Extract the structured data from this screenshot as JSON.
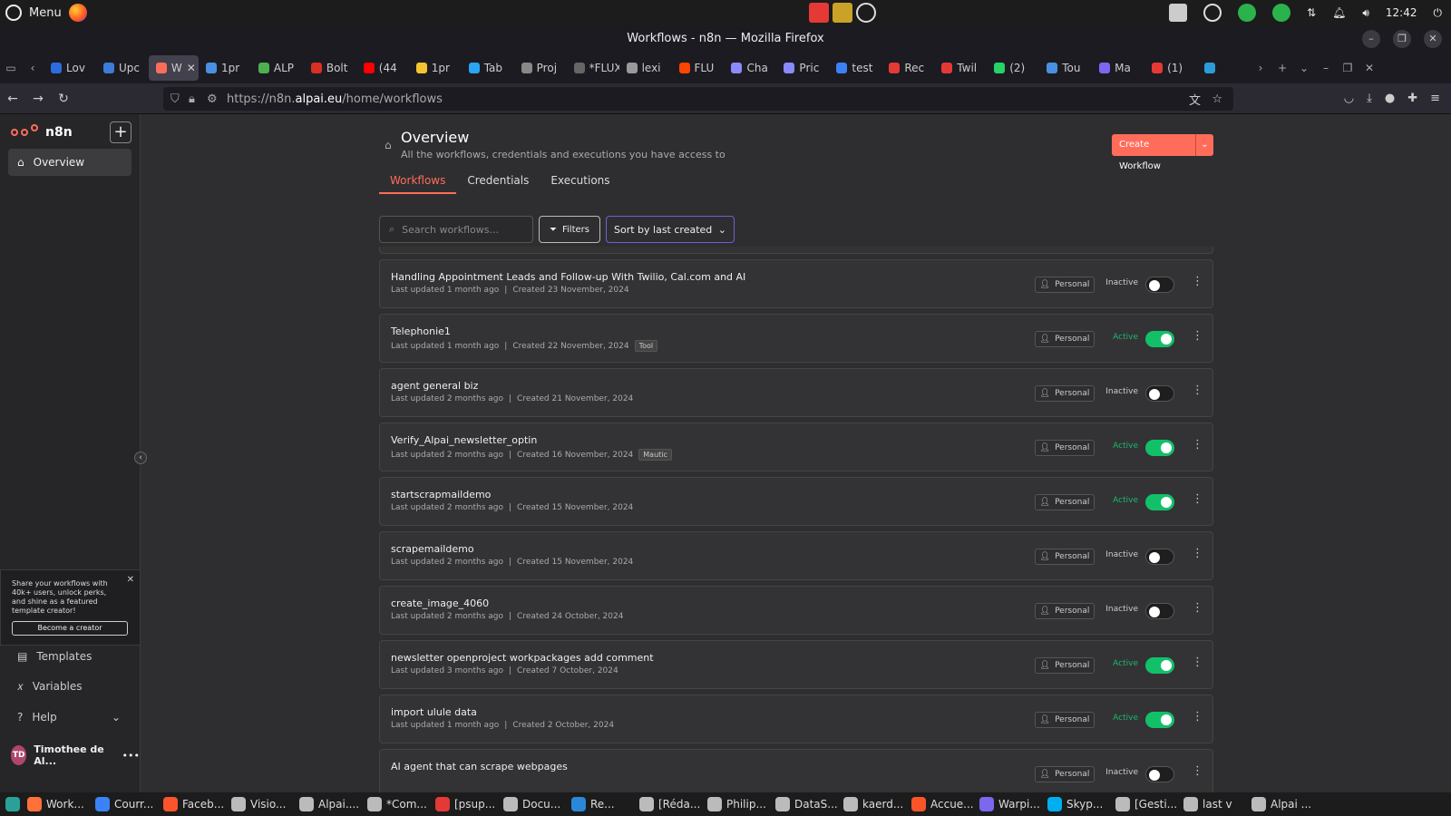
{
  "system": {
    "menu_label": "Menu",
    "clock": "12:42"
  },
  "window": {
    "title": "Workflows - n8n — Mozilla Firefox"
  },
  "browser_tabs": [
    {
      "label": "Lov",
      "color": "#2d6cdf"
    },
    {
      "label": "Upc",
      "color": "#3d7bd9"
    },
    {
      "label": "W",
      "color": "#ff6d5a",
      "active": true
    },
    {
      "label": "1pr",
      "color": "#4a90e2"
    },
    {
      "label": "ALP",
      "color": "#4caf50"
    },
    {
      "label": "Bolt",
      "color": "#d93025"
    },
    {
      "label": "(44",
      "color": "#ff0000"
    },
    {
      "label": "1pr",
      "color": "#f4c430"
    },
    {
      "label": "Tab",
      "color": "#2aa4f4"
    },
    {
      "label": "Proj",
      "color": "#888888"
    },
    {
      "label": "*FLUX",
      "color": "#666666"
    },
    {
      "label": "lexi",
      "color": "#999999"
    },
    {
      "label": "FLU",
      "color": "#ff4500"
    },
    {
      "label": "Cha",
      "color": "#8a8aff"
    },
    {
      "label": "Pric",
      "color": "#8a8aff"
    },
    {
      "label": "test",
      "color": "#3b82f6"
    },
    {
      "label": "Rec",
      "color": "#e53935"
    },
    {
      "label": "Twil",
      "color": "#e53935"
    },
    {
      "label": "(2)",
      "color": "#25d366"
    },
    {
      "label": "Tou",
      "color": "#4a90e2"
    },
    {
      "label": "Ma",
      "color": "#7b68ee"
    },
    {
      "label": "(1)",
      "color": "#e53935"
    },
    {
      "label": "",
      "color": "#2d9cdb"
    }
  ],
  "url": {
    "prefix": "https://n8n.",
    "host": "alpai.eu",
    "path": "/home/workflows"
  },
  "sidebar": {
    "brand": "n8n",
    "overview": "Overview",
    "templates": "Templates",
    "variables": "Variables",
    "help": "Help",
    "promo_text": "Share your workflows with 40k+ users, unlock perks, and shine as a featured template creator!",
    "promo_cta": "Become a creator",
    "user_initials": "TD",
    "user_name": "Timothee de Al..."
  },
  "header": {
    "title": "Overview",
    "subtitle": "All the workflows, credentials and executions you have access to",
    "create_label": "Create Workflow"
  },
  "tabs": {
    "workflows": "Workflows",
    "credentials": "Credentials",
    "executions": "Executions"
  },
  "toolbar": {
    "search_placeholder": "Search workflows...",
    "filters": "Filters",
    "sort": "Sort by last created"
  },
  "workflows": [
    {
      "name": "Handling Appointment Leads and Follow-up With Twilio, Cal.com and AI",
      "updated": "Last updated 1 month ago",
      "created": "Created 23 November, 2024",
      "tag": "",
      "owner": "Personal",
      "status": "Inactive",
      "active": false
    },
    {
      "name": "Telephonie1",
      "updated": "Last updated 1 month ago",
      "created": "Created 22 November, 2024",
      "tag": "Tool",
      "owner": "Personal",
      "status": "Active",
      "active": true
    },
    {
      "name": "agent general biz",
      "updated": "Last updated 2 months ago",
      "created": "Created 21 November, 2024",
      "tag": "",
      "owner": "Personal",
      "status": "Inactive",
      "active": false
    },
    {
      "name": "Verify_Alpai_newsletter_optin",
      "updated": "Last updated 2 months ago",
      "created": "Created 16 November, 2024",
      "tag": "Mautic",
      "owner": "Personal",
      "status": "Active",
      "active": true
    },
    {
      "name": "startscrapmaildemo",
      "updated": "Last updated 2 months ago",
      "created": "Created 15 November, 2024",
      "tag": "",
      "owner": "Personal",
      "status": "Active",
      "active": true
    },
    {
      "name": "scrapemaildemo",
      "updated": "Last updated 2 months ago",
      "created": "Created 15 November, 2024",
      "tag": "",
      "owner": "Personal",
      "status": "Inactive",
      "active": false
    },
    {
      "name": "create_image_4060",
      "updated": "Last updated 2 months ago",
      "created": "Created 24 October, 2024",
      "tag": "",
      "owner": "Personal",
      "status": "Inactive",
      "active": false
    },
    {
      "name": "newsletter openproject workpackages add comment",
      "updated": "Last updated 3 months ago",
      "created": "Created 7 October, 2024",
      "tag": "",
      "owner": "Personal",
      "status": "Active",
      "active": true
    },
    {
      "name": "import ulule data",
      "updated": "Last updated 1 month ago",
      "created": "Created 2 October, 2024",
      "tag": "",
      "owner": "Personal",
      "status": "Active",
      "active": true
    },
    {
      "name": "AI agent that can scrape webpages",
      "updated": "",
      "created": "",
      "tag": "",
      "owner": "Personal",
      "status": "Inactive",
      "active": false
    }
  ],
  "taskbar": [
    {
      "label": "Work...",
      "color": "#ff7139"
    },
    {
      "label": "Courr...",
      "color": "#3b82f6"
    },
    {
      "label": "Faceb...",
      "color": "#fb542b"
    },
    {
      "label": "Visio...",
      "color": "#bbbbbb"
    },
    {
      "label": "Alpai....",
      "color": "#bbbbbb"
    },
    {
      "label": "*Com...",
      "color": "#bbbbbb"
    },
    {
      "label": "[psup...",
      "color": "#e53935"
    },
    {
      "label": "Docu...",
      "color": "#bbbbbb"
    },
    {
      "label": "Re...",
      "color": "#2b88d8"
    },
    {
      "label": "[Réda...",
      "color": "#bbbbbb"
    },
    {
      "label": "Philip...",
      "color": "#bbbbbb"
    },
    {
      "label": "DataS...",
      "color": "#bbbbbb"
    },
    {
      "label": "kaerd...",
      "color": "#bbbbbb"
    },
    {
      "label": "Accue...",
      "color": "#fb542b"
    },
    {
      "label": "Warpi...",
      "color": "#7b68ee"
    },
    {
      "label": "Skyp...",
      "color": "#00aff0"
    },
    {
      "label": "[Gesti...",
      "color": "#bbbbbb"
    },
    {
      "label": "last v",
      "color": "#bbbbbb"
    },
    {
      "label": "Alpai ...",
      "color": "#bbbbbb"
    }
  ]
}
